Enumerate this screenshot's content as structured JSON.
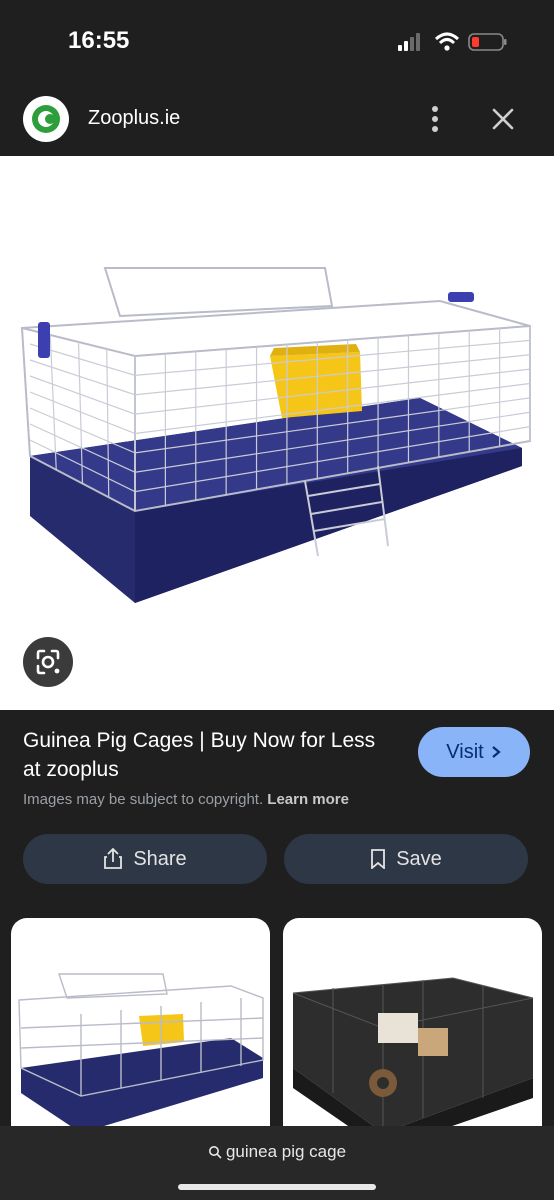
{
  "status_bar": {
    "time": "16:55"
  },
  "header": {
    "site_name": "Zooplus.ie"
  },
  "result": {
    "title": "Guinea Pig Cages | Buy Now for Less at zooplus",
    "visit_label": "Visit",
    "copyright_text": "Images may be subject to copyright.",
    "learn_more": "Learn more",
    "share_label": "Share",
    "save_label": "Save"
  },
  "search": {
    "query": "guinea pig cage"
  },
  "colors": {
    "background": "#1f1f1f",
    "accent": "#8ab4f8",
    "cage_base": "#2a2f7a",
    "cage_door": "#f5c518"
  }
}
